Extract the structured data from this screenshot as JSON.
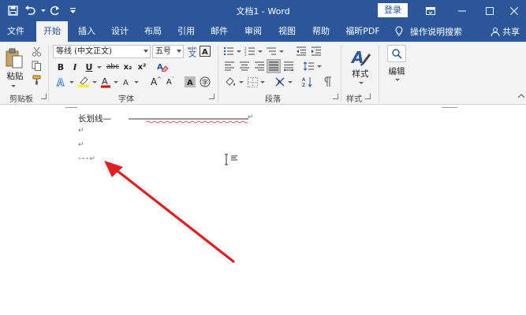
{
  "window": {
    "title": "文档1 - Word",
    "login_label": "登录"
  },
  "tabs": [
    {
      "label": "文件",
      "active": false
    },
    {
      "label": "开始",
      "active": true
    },
    {
      "label": "插入",
      "active": false
    },
    {
      "label": "设计",
      "active": false
    },
    {
      "label": "布局",
      "active": false
    },
    {
      "label": "引用",
      "active": false
    },
    {
      "label": "邮件",
      "active": false
    },
    {
      "label": "审阅",
      "active": false
    },
    {
      "label": "视图",
      "active": false
    },
    {
      "label": "帮助",
      "active": false
    },
    {
      "label": "福昕PDF",
      "active": false
    }
  ],
  "tell_me": "操作说明搜索",
  "share": "共享",
  "ribbon": {
    "clipboard": {
      "paste_label": "粘贴",
      "group_label": "剪贴板"
    },
    "font": {
      "font_name": "等线 (中文正文)",
      "font_size": "五号",
      "bold": "B",
      "italic": "I",
      "underline": "U",
      "strike": "abc",
      "subscript": "x₂",
      "superscript": "x²",
      "grow": "A",
      "shrink": "A",
      "group_label": "字体"
    },
    "paragraph": {
      "group_label": "段落"
    },
    "styles": {
      "label": "样式",
      "group_label": "样式"
    },
    "editing": {
      "label": "编辑"
    }
  },
  "document": {
    "line1": "长划线—",
    "line4": "---",
    "para_mark": "↵"
  },
  "colors": {
    "accent": "#2b579a",
    "highlight": "#ffff00",
    "font_color": "#e00000",
    "arrow": "#e02020"
  }
}
